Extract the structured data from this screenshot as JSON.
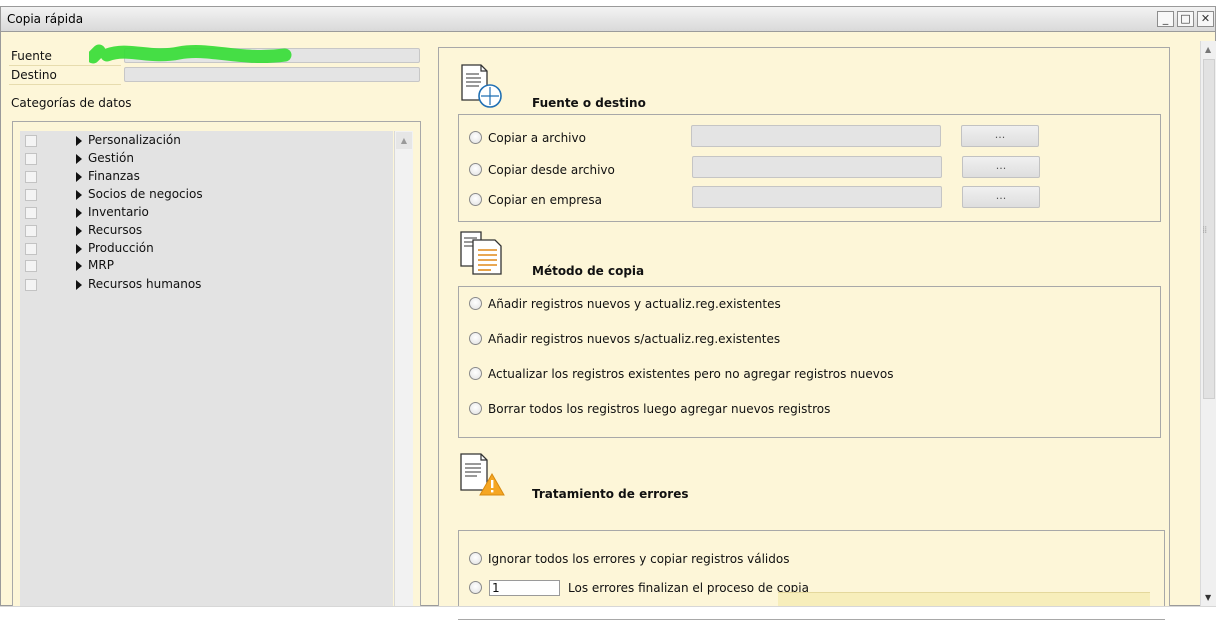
{
  "window": {
    "title": "Copia rápida",
    "controls": [
      "_",
      "□",
      "✕"
    ]
  },
  "left": {
    "fuente_label": "Fuente",
    "destino_label": "Destino",
    "categorias_label": "Categorías de datos",
    "categories": [
      "Personalización",
      "Gestión",
      "Finanzas",
      "Socios de negocios",
      "Inventario",
      "Recursos",
      "Producción",
      "MRP",
      "Recursos humanos"
    ]
  },
  "source_dest": {
    "title": "Fuente o destino",
    "icon": "document-target-icon",
    "options": [
      {
        "label": "Copiar a archivo",
        "browse": "..."
      },
      {
        "label": "Copiar desde archivo",
        "browse": "..."
      },
      {
        "label": "Copiar en empresa",
        "browse": "..."
      }
    ]
  },
  "method": {
    "title": "Método de copia",
    "icon": "documents-copy-icon",
    "options": [
      "Añadir registros nuevos y actualiz.reg.existentes",
      "Añadir registros nuevos s/actualiz.reg.existentes",
      "Actualizar los registros existentes pero no agregar registros nuevos",
      "Borrar todos los registros luego agregar nuevos registros"
    ]
  },
  "errors": {
    "title": "Tratamiento de errores",
    "icon": "document-warning-icon",
    "ignore_label": "Ignorar todos los errores y copiar registros válidos",
    "count_value": "1",
    "count_label": "Los errores finalizan el proceso de copia"
  },
  "colors": {
    "background": "#fdf6d8",
    "field": "#e4e4e4",
    "warning": "#f5a623",
    "clock_blue": "#1f6fb3"
  }
}
